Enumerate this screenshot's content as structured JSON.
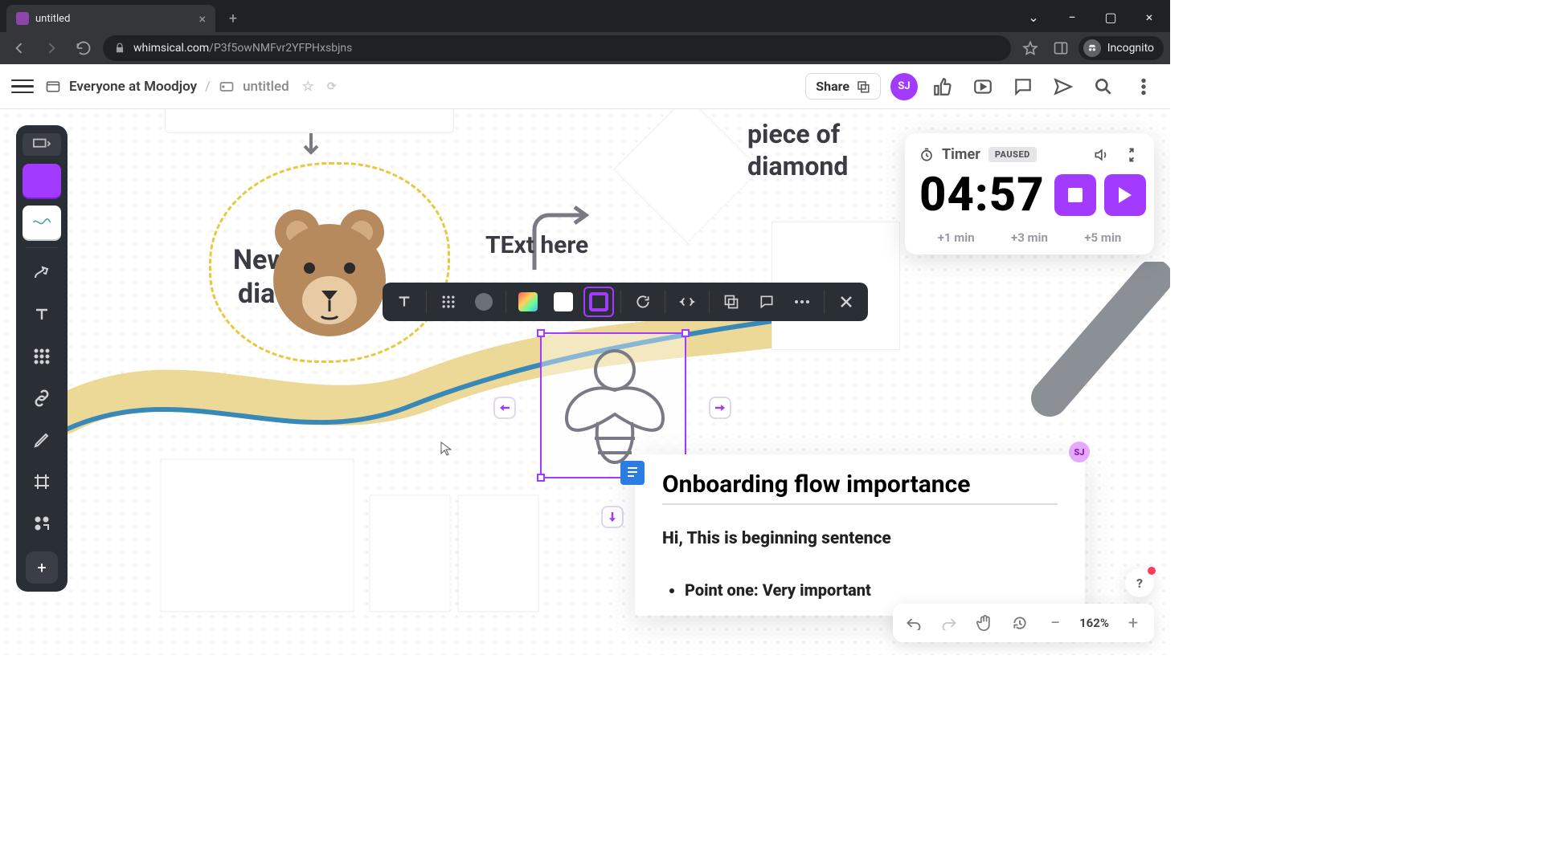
{
  "browser": {
    "tab_title": "untitled",
    "url_domain": "whimsical.com",
    "url_path": "/P3f5owNMFvr2YFPHxsbjns",
    "incognito_label": "Incognito"
  },
  "header": {
    "hamburger": "menu",
    "workspace": "Everyone at Moodjoy",
    "sep": "/",
    "doc_title": "untitled",
    "share": "Share",
    "avatar_initials": "SJ"
  },
  "canvas": {
    "text_new": "New",
    "text_dia": "dia",
    "text_here": "TExt here",
    "piece_of": "piece of",
    "diamond": "diamond"
  },
  "context_toolbar": {
    "items": [
      "text",
      "grid",
      "circle",
      "image",
      "fill",
      "border",
      "rotate",
      "constrain",
      "duplicate",
      "comment",
      "more",
      "close"
    ]
  },
  "timer": {
    "label": "Timer",
    "badge": "PAUSED",
    "value": "04:57",
    "add1": "+1 min",
    "add3": "+3 min",
    "add5": "+5 min"
  },
  "doc_card": {
    "title": "Onboarding flow importance",
    "body": "Hi, This is beginning sentence",
    "bullet1": "Point one: Very important",
    "cursor_initials": "SJ"
  },
  "zoom": {
    "level": "162%"
  }
}
